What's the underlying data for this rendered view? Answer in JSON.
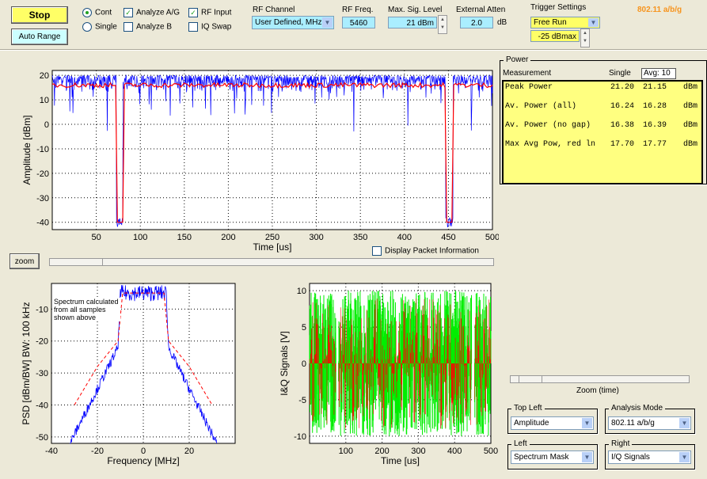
{
  "toolbar": {
    "stop": "Stop",
    "auto_range": "Auto Range",
    "cont": "Cont",
    "single": "Single",
    "analyze_ag": "Analyze A/G",
    "analyze_b": "Analyze B",
    "rf_input": "RF Input",
    "iq_swap": "IQ Swap",
    "rf_channel_label": "RF Channel",
    "rf_channel_value": "User Defined, MHz:",
    "rf_freq_label": "RF Freq.",
    "rf_freq_value": "5460",
    "max_sig_label": "Max. Sig. Level",
    "max_sig_value": "21 dBm",
    "ext_atten_label": "External Atten",
    "ext_atten_value": "2.0",
    "ext_atten_unit": "dB",
    "trigger_label": "Trigger Settings",
    "trigger_mode": "Free Run",
    "trigger_level": "-25 dBmax",
    "standard": "802.11 a/b/g"
  },
  "checks": {
    "cont": true,
    "single": false,
    "analyze_ag": true,
    "analyze_b": false,
    "rf_input": true,
    "iq_swap": false
  },
  "power": {
    "title": "Power",
    "col_measurement": "Measurement",
    "col_single": "Single",
    "col_avg": "Avg: 10",
    "rows": [
      {
        "name": "Peak Power",
        "single": "21.20",
        "avg": "21.15",
        "unit": "dBm"
      },
      {
        "name": "Av. Power (all)",
        "single": "16.24",
        "avg": "16.28",
        "unit": "dBm"
      },
      {
        "name": "Av. Power (no gap)",
        "single": "16.38",
        "avg": "16.39",
        "unit": "dBm"
      },
      {
        "name": "Max Avg Pow, red ln",
        "single": "17.70",
        "avg": "17.77",
        "unit": "dBm"
      }
    ]
  },
  "zoom_button": "zoom",
  "display_packet": "Display Packet Information",
  "zoom_time": "Zoom (time)",
  "selectors": {
    "top_left_label": "Top Left",
    "top_left": "Amplitude",
    "analysis_label": "Analysis Mode",
    "analysis": "802.11 a/b/g",
    "left_label": "Left",
    "left": "Spectrum Mask",
    "right_label": "Right",
    "right": "I/Q Signals"
  },
  "colors": {
    "signal": "#0000ff",
    "average": "#ff0000",
    "iq_i": "#00ee00",
    "iq_q": "#ff0000",
    "panel": "#ffff80"
  },
  "chart_data": [
    {
      "type": "line",
      "xlabel": "Time [us]",
      "ylabel": "Amplitude [dBm]",
      "xlim": [
        0,
        500
      ],
      "ylim": [
        -43,
        22
      ],
      "xticks": [
        50,
        100,
        150,
        200,
        250,
        300,
        350,
        400,
        450,
        500
      ],
      "yticks": [
        20,
        10,
        0,
        -10,
        -20,
        -30,
        -40
      ],
      "grid": true,
      "series": [
        {
          "color": "#0000ff",
          "level_range": [
            -5,
            20
          ],
          "gaps_us": [
            [
              73,
              80
            ],
            [
              447,
              455
            ]
          ],
          "gap_level": -40
        },
        {
          "color": "#ff0000",
          "level": 16
        }
      ]
    },
    {
      "type": "line",
      "xlabel": "Frequency [MHz]",
      "ylabel": "PSD  [dBm/BW]  BW: 100 kHz",
      "annotation": "Spectrum calculated from all samples shown above",
      "xlim": [
        -40,
        40
      ],
      "ylim": [
        -52,
        -2
      ],
      "xticks": [
        -40,
        -20,
        0,
        20
      ],
      "yticks": [
        -10,
        -20,
        -30,
        -40,
        -50
      ],
      "grid": true,
      "series": [
        {
          "color": "#0000ff",
          "points": [
            [
              -32,
              -52
            ],
            [
              -20,
              -35
            ],
            [
              -11,
              -22
            ],
            [
              -10,
              -5
            ],
            [
              10,
              -5
            ],
            [
              11,
              -22
            ],
            [
              20,
              -35
            ],
            [
              32,
              -52
            ]
          ]
        },
        {
          "color": "#ff0000",
          "points": [
            [
              -30,
              -40
            ],
            [
              -20,
              -28
            ],
            [
              -11,
              -20
            ],
            [
              -9,
              -5
            ],
            [
              9,
              -5
            ],
            [
              11,
              -20
            ],
            [
              20,
              -28
            ],
            [
              30,
              -40
            ]
          ]
        }
      ]
    },
    {
      "type": "line",
      "xlabel": "Time [us]",
      "ylabel": "I&Q Signals [V]",
      "xlim": [
        0,
        500
      ],
      "ylim": [
        -11,
        11
      ],
      "xticks": [
        100,
        200,
        300,
        400,
        500
      ],
      "yticks": [
        10,
        5,
        0,
        -5,
        -10
      ],
      "grid": true,
      "series": [
        {
          "color": "#00ee00",
          "amplitude": 10
        },
        {
          "color": "#ff0000",
          "amplitude": 10
        }
      ]
    }
  ]
}
